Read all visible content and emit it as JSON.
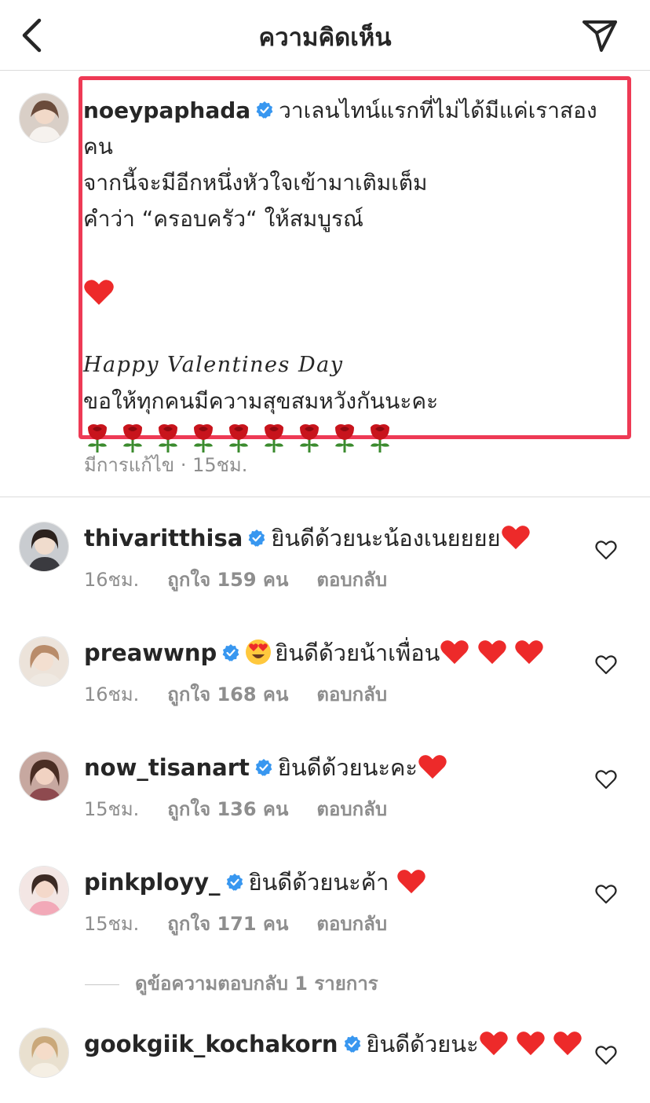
{
  "header": {
    "title": "ความคิดเห็น",
    "back_icon": "chevron-left-icon",
    "share_icon": "paper-plane-icon"
  },
  "caption": {
    "username": "noeypaphada",
    "line1": "วาเลนไทน์แรกที่ไม่ได้มีแค่เราสอง",
    "line2": "คน",
    "line3": "จากนี้จะมีอีกหนึ่งหัวใจเข้ามาเติมเต็ม",
    "line4": "คำว่า “ครอบครัว“ ให้สมบูรณ์",
    "line5": "Happy Valentines Day",
    "line6": "ขอให้ทุกคนมีความสุขสมหวังกันนะคะ",
    "edited": "มีการแก้ไข · 15ชม.",
    "highlight_color": "#ee3a55"
  },
  "comments": [
    {
      "username": "thivaritthisa",
      "text": "ยินดีด้วยนะน้องเนยยยย",
      "time": "16ชม.",
      "likes": "ถูกใจ 159 คน",
      "reply": "ตอบกลับ"
    },
    {
      "username": "preawwnp",
      "text": "ยินดีด้วยน้าเพื่อน",
      "time": "16ชม.",
      "likes": "ถูกใจ 168 คน",
      "reply": "ตอบกลับ"
    },
    {
      "username": "now_tisanart",
      "text": "ยินดีด้วยนะคะ",
      "time": "15ชม.",
      "likes": "ถูกใจ 136 คน",
      "reply": "ตอบกลับ"
    },
    {
      "username": "pinkployy_",
      "text": "ยินดีด้วยนะค้า",
      "time": "15ชม.",
      "likes": "ถูกใจ 171 คน",
      "reply": "ตอบกลับ"
    },
    {
      "username": "gookgiik_kochakorn",
      "text": "ยินดีด้วยนะ"
    }
  ],
  "view_replies": "ดูข้อความตอบกลับ 1 รายการ",
  "colors": {
    "verified": "#3897f0",
    "heart": "#ed2a2a",
    "secondary_text": "#8e8e8e"
  }
}
